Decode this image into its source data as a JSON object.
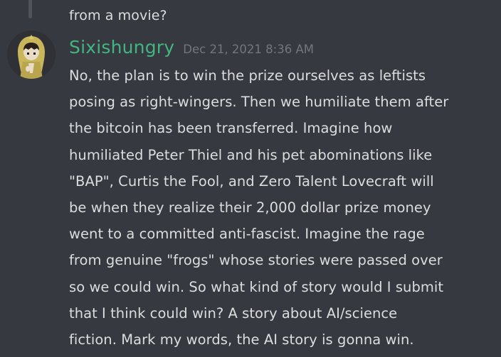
{
  "thread": {
    "previous_message_text": "from a movie?"
  },
  "message": {
    "author": {
      "username": "Sixishungry",
      "name_color": "#43b581",
      "avatar_icon": "hooded-figure-avatar"
    },
    "timestamp": "Dec 21, 2021 8:36 AM",
    "content_lines": [
      "No, the plan is to win the prize ourselves as leftists",
      "posing as right-wingers. Then we humiliate them after",
      "the bitcoin has been transferred. Imagine how",
      "humiliated Peter Thiel and his pet abominations like",
      "\"BAP\", Curtis the Fool, and Zero Talent Lovecraft will",
      "be when they realize their 2,000 dollar prize money",
      "went to a committed anti-fascist. Imagine the rage",
      "from genuine \"frogs\" whose stories were passed over",
      "so we could win. So what kind of story would I submit",
      "that I think could win? A story about AI/science",
      "fiction. Mark my words, the AI story is gonna win."
    ]
  },
  "colors": {
    "background": "#36393f",
    "text": "#dcddde",
    "muted": "#72767d",
    "thread_line": "#4f545c"
  }
}
